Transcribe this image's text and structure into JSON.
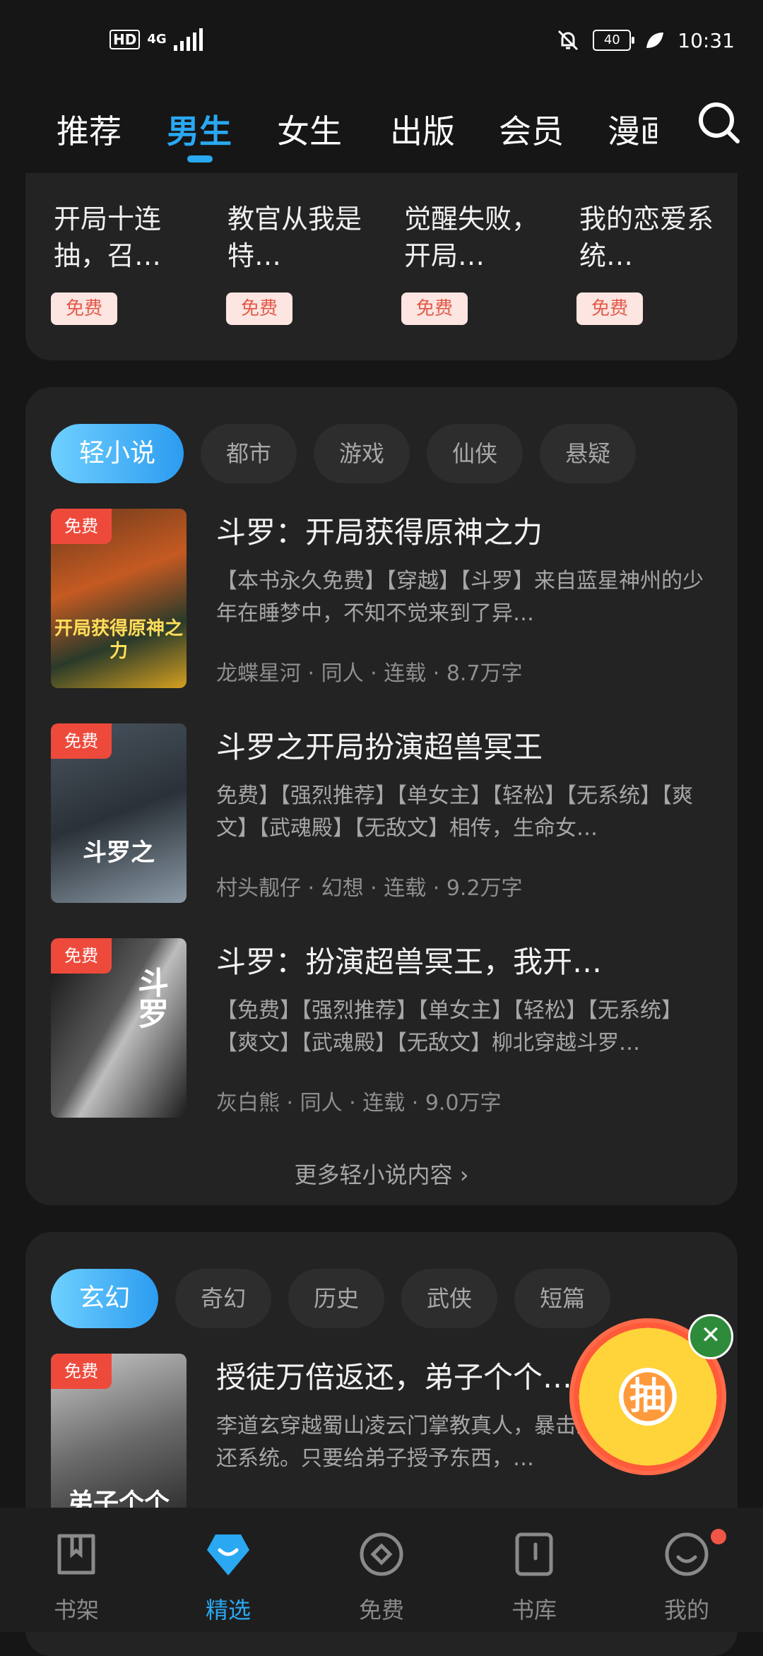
{
  "status": {
    "hd": "HD",
    "network": "4G",
    "battery": "40",
    "time": "10:31"
  },
  "tabs": [
    "推荐",
    "男生",
    "女生",
    "出版",
    "会员",
    "漫画"
  ],
  "active_tab": "男生",
  "top_grid": [
    {
      "title": "开局十连抽，召…",
      "badge": "免费"
    },
    {
      "title": "教官从我是特…",
      "badge": "免费"
    },
    {
      "title": "觉醒失败，开局…",
      "badge": "免费"
    },
    {
      "title": "我的恋爱系统…",
      "badge": "免费"
    }
  ],
  "section1": {
    "chips": [
      "轻小说",
      "都市",
      "游戏",
      "仙侠",
      "悬疑"
    ],
    "books": [
      {
        "badge": "免费",
        "title": "斗罗：开局获得原神之力",
        "desc": "【本书永久免费】【穿越】【斗罗】来自蓝星神州的少年在睡梦中，不知不觉来到了异…",
        "meta": "龙蝶星河 · 同人 · 连载 · 8.7万字",
        "cover_text": "开局获得原神之力"
      },
      {
        "badge": "免费",
        "title": "斗罗之开局扮演超兽冥王",
        "desc": "免费】【强烈推荐】【单女主】【轻松】【无系统】【爽文】【武魂殿】【无敌文】相传，生命女…",
        "meta": "村头靓仔 · 幻想 · 连载 · 9.2万字",
        "cover_text": "斗罗之"
      },
      {
        "badge": "免费",
        "title": "斗罗：扮演超兽冥王，我开…",
        "desc": "【免费】【强烈推荐】【单女主】【轻松】【无系统】【爽文】【武魂殿】【无敌文】柳北穿越斗罗…",
        "meta": "灰白熊 · 同人 · 连载 · 9.0万字",
        "cover_text": "斗罗"
      }
    ],
    "more": "更多轻小说内容"
  },
  "section2": {
    "chips": [
      "玄幻",
      "奇幻",
      "历史",
      "武侠",
      "短篇"
    ],
    "books": [
      {
        "badge": "免费",
        "title": "授徒万倍返还，弟子个个…",
        "desc": "李道玄穿越蜀山凌云门掌教真人，暴击返还系统。只要给弟子授予东西，…",
        "cover_text": "弟子个个"
      }
    ]
  },
  "lottery": {
    "label": "抽"
  },
  "bottom_nav": [
    {
      "label": "书架",
      "icon": "bookshelf-icon"
    },
    {
      "label": "精选",
      "icon": "featured-icon"
    },
    {
      "label": "免费",
      "icon": "free-icon"
    },
    {
      "label": "书库",
      "icon": "library-icon"
    },
    {
      "label": "我的",
      "icon": "profile-icon"
    }
  ],
  "active_nav": "精选",
  "colors": {
    "accent": "#2aa8f2",
    "background": "#161616",
    "card": "#232323",
    "free_badge": "#ee4a3c"
  }
}
